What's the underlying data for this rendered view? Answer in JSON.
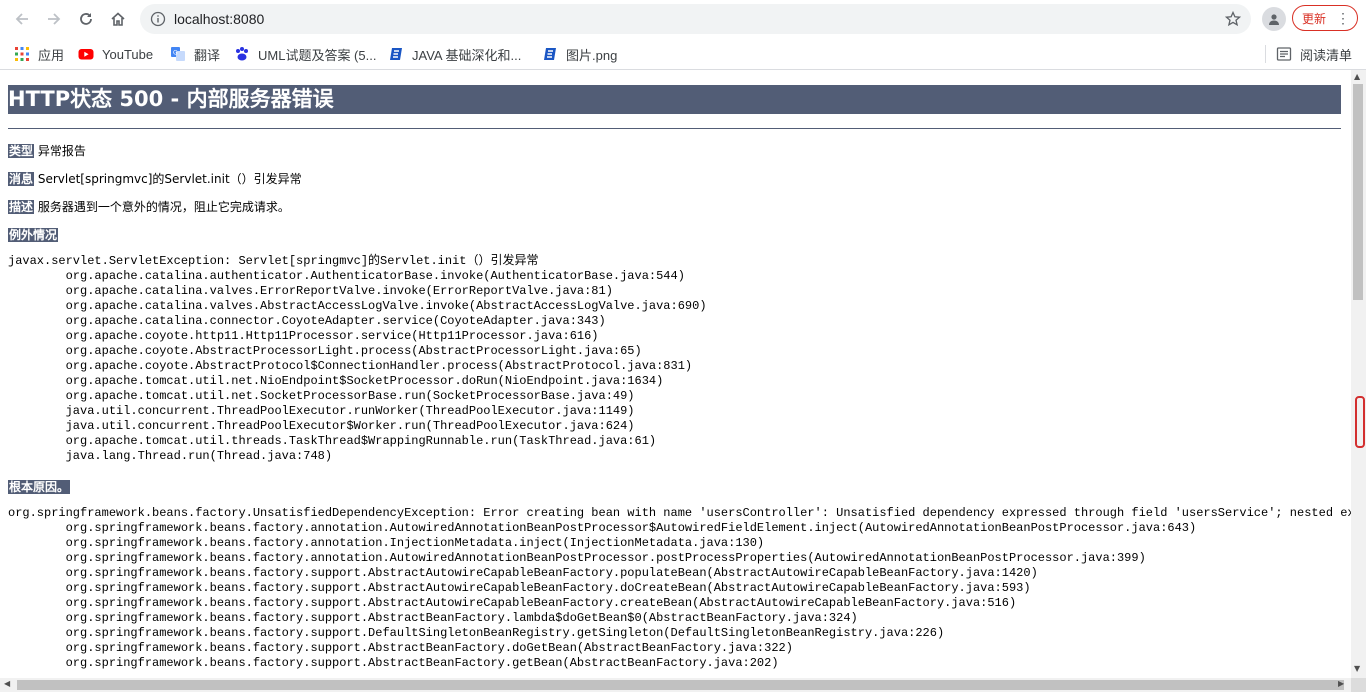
{
  "browser": {
    "url": "localhost:8080",
    "update_label": "更新",
    "bookmarks": [
      {
        "label": "应用",
        "icon": "apps-grid-icon"
      },
      {
        "label": "YouTube",
        "icon": "youtube-icon"
      },
      {
        "label": "翻译",
        "icon": "translate-icon"
      },
      {
        "label": "UML试题及答案 (5...",
        "icon": "baidu-paw-icon"
      },
      {
        "label": "JAVA 基础深化和...",
        "icon": "doc-e-icon"
      },
      {
        "label": "图片.png",
        "icon": "doc-e-icon"
      }
    ],
    "reading_list": "阅读清单",
    "colors": {
      "update": "#d93025",
      "youtube": "#ff0000"
    }
  },
  "page": {
    "title": "HTTP状态 500 - 内部服务器错误",
    "type_label": "类型",
    "type_value": "异常报告",
    "message_label": "消息",
    "message_value": "Servlet[springmvc]的Servlet.init（）引发异常",
    "description_label": "描述",
    "description_value": "服务器遇到一个意外的情况，阻止它完成请求。",
    "exception_label": "例外情况",
    "exception_trace": "javax.servlet.ServletException: Servlet[springmvc]的Servlet.init（）引发异常\n\torg.apache.catalina.authenticator.AuthenticatorBase.invoke(AuthenticatorBase.java:544)\n\torg.apache.catalina.valves.ErrorReportValve.invoke(ErrorReportValve.java:81)\n\torg.apache.catalina.valves.AbstractAccessLogValve.invoke(AbstractAccessLogValve.java:690)\n\torg.apache.catalina.connector.CoyoteAdapter.service(CoyoteAdapter.java:343)\n\torg.apache.coyote.http11.Http11Processor.service(Http11Processor.java:616)\n\torg.apache.coyote.AbstractProcessorLight.process(AbstractProcessorLight.java:65)\n\torg.apache.coyote.AbstractProtocol$ConnectionHandler.process(AbstractProtocol.java:831)\n\torg.apache.tomcat.util.net.NioEndpoint$SocketProcessor.doRun(NioEndpoint.java:1634)\n\torg.apache.tomcat.util.net.SocketProcessorBase.run(SocketProcessorBase.java:49)\n\tjava.util.concurrent.ThreadPoolExecutor.runWorker(ThreadPoolExecutor.java:1149)\n\tjava.util.concurrent.ThreadPoolExecutor$Worker.run(ThreadPoolExecutor.java:624)\n\torg.apache.tomcat.util.threads.TaskThread$WrappingRunnable.run(TaskThread.java:61)\n\tjava.lang.Thread.run(Thread.java:748)",
    "root_cause_label": "根本原因。",
    "root_cause_trace": "org.springframework.beans.factory.UnsatisfiedDependencyException: Error creating bean with name 'usersController': Unsatisfied dependency expressed through field 'usersService'; nested excepti\n\torg.springframework.beans.factory.annotation.AutowiredAnnotationBeanPostProcessor$AutowiredFieldElement.inject(AutowiredAnnotationBeanPostProcessor.java:643)\n\torg.springframework.beans.factory.annotation.InjectionMetadata.inject(InjectionMetadata.java:130)\n\torg.springframework.beans.factory.annotation.AutowiredAnnotationBeanPostProcessor.postProcessProperties(AutowiredAnnotationBeanPostProcessor.java:399)\n\torg.springframework.beans.factory.support.AbstractAutowireCapableBeanFactory.populateBean(AbstractAutowireCapableBeanFactory.java:1420)\n\torg.springframework.beans.factory.support.AbstractAutowireCapableBeanFactory.doCreateBean(AbstractAutowireCapableBeanFactory.java:593)\n\torg.springframework.beans.factory.support.AbstractAutowireCapableBeanFactory.createBean(AbstractAutowireCapableBeanFactory.java:516)\n\torg.springframework.beans.factory.support.AbstractBeanFactory.lambda$doGetBean$0(AbstractBeanFactory.java:324)\n\torg.springframework.beans.factory.support.DefaultSingletonBeanRegistry.getSingleton(DefaultSingletonBeanRegistry.java:226)\n\torg.springframework.beans.factory.support.AbstractBeanFactory.doGetBean(AbstractBeanFactory.java:322)\n\torg.springframework.beans.factory.support.AbstractBeanFactory.getBean(AbstractBeanFactory.java:202)",
    "colors": {
      "header_bg": "#525d76"
    }
  }
}
